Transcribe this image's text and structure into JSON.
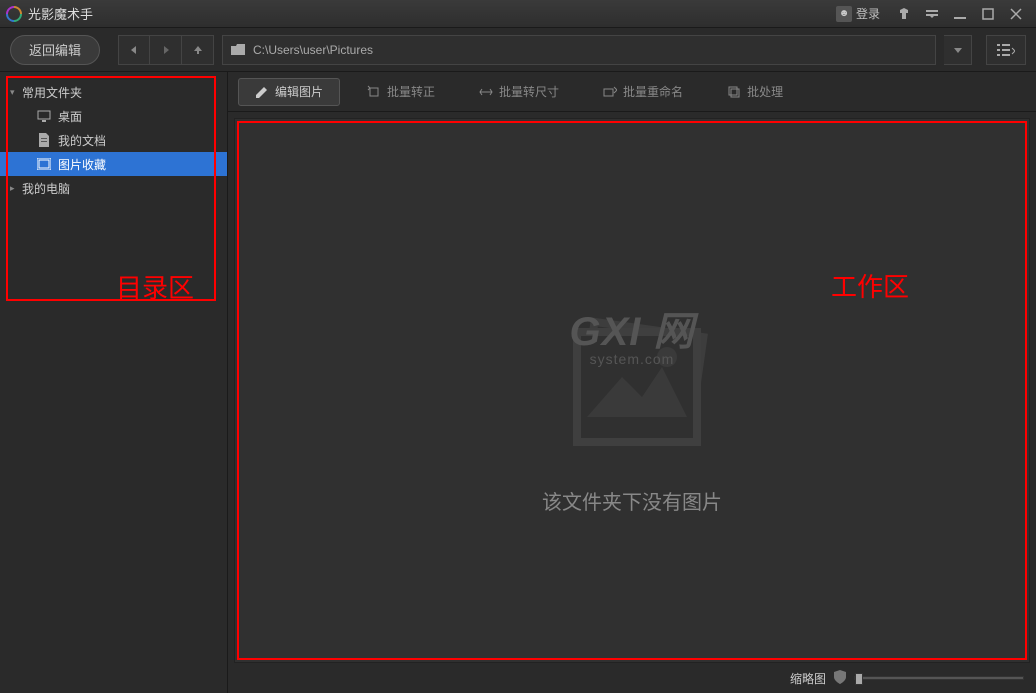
{
  "titlebar": {
    "app_name": "光影魔术手",
    "login_label": "登录"
  },
  "toolbar": {
    "back_label": "返回编辑",
    "path": "C:\\Users\\user\\Pictures"
  },
  "sidebar": {
    "items": [
      {
        "label": "常用文件夹",
        "level": 1,
        "expanded": true,
        "icon": "folder"
      },
      {
        "label": "桌面",
        "level": 2,
        "icon": "desktop"
      },
      {
        "label": "我的文档",
        "level": 2,
        "icon": "doc"
      },
      {
        "label": "图片收藏",
        "level": 2,
        "icon": "picfav",
        "selected": true
      },
      {
        "label": "我的电脑",
        "level": 1,
        "expanded": false,
        "icon": "pc"
      }
    ]
  },
  "actions": {
    "edit": "编辑图片",
    "batch_transfer": "批量转正",
    "batch_resize": "批量转尺寸",
    "batch_rename": "批量重命名",
    "batch_process": "批处理"
  },
  "workspace": {
    "watermark_big": "GXI 网",
    "watermark_small": "system.com",
    "empty_text": "该文件夹下没有图片"
  },
  "statusbar": {
    "thumb_label": "缩略图"
  },
  "annotations": {
    "sidebar_label": "目录区",
    "workspace_label": "工作区"
  }
}
